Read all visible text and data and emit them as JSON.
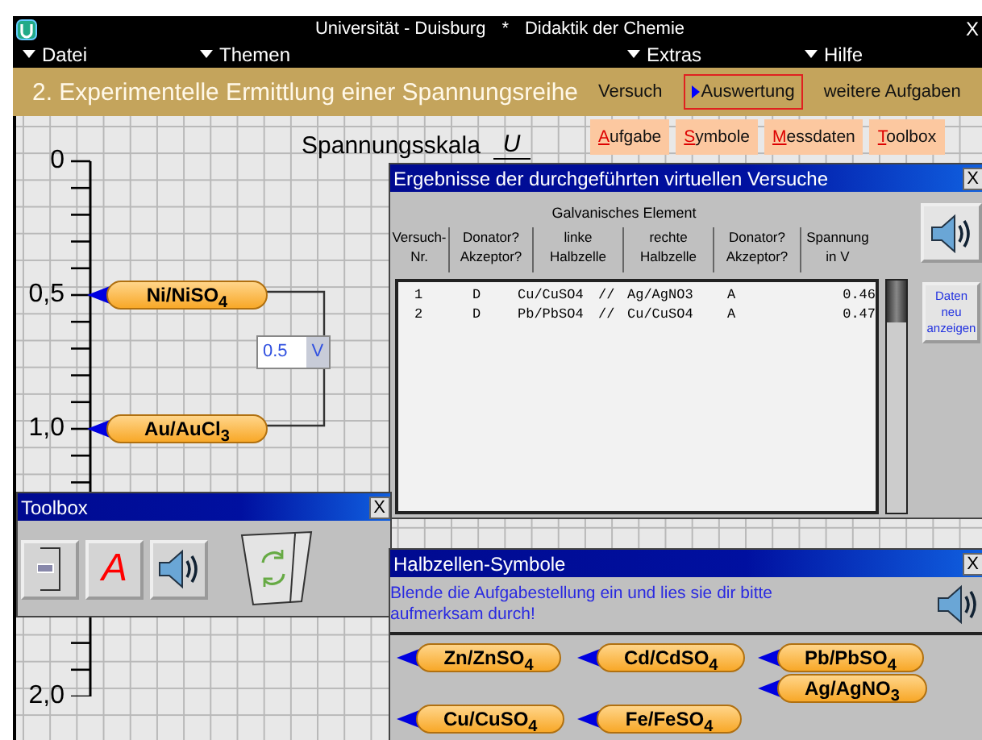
{
  "window": {
    "title_left": "Universität - Duisburg",
    "title_separator": "*",
    "title_right": "Didaktik der Chemie",
    "close": "X"
  },
  "menu": [
    {
      "label": "Datei"
    },
    {
      "label": "Themen"
    },
    {
      "label": "Extras"
    },
    {
      "label": "Hilfe"
    }
  ],
  "header": {
    "title": "2. Experimentelle Ermittlung einer Spannungsreihe",
    "nav": [
      {
        "label": "Versuch",
        "selected": false
      },
      {
        "label": "Auswertung",
        "selected": true
      },
      {
        "label": "weitere Aufgaben",
        "selected": false
      }
    ]
  },
  "subtabs": [
    {
      "label": "Aufgabe"
    },
    {
      "label": "Symbole"
    },
    {
      "label": "Messdaten"
    },
    {
      "label": "Toolbox"
    }
  ],
  "scale": {
    "title": "Spannungsskala",
    "unit_numerator": "U",
    "labels": [
      "0",
      "0,5",
      "1,0",
      "2,0"
    ]
  },
  "cells_on_scale": [
    {
      "label": "Ni/NiSO$_{4}$"
    },
    {
      "label": "Au/AuCl$_{3}$"
    }
  ],
  "voltmeter": {
    "value": "0.5",
    "unit": "V"
  },
  "results": {
    "title": "Ergebnisse der durchgeführten virtuellen Versuche",
    "close": "X",
    "group_header": "Galvanisches Element",
    "columns": [
      "Versuch-\nNr.",
      "Donator?\nAkzeptor?",
      "linke\nHalbzelle",
      "rechte\nHalbzelle",
      "Donator?\nAkzeptor?",
      "Spannung\nin V"
    ],
    "rows": [
      {
        "nr": "1",
        "left_role": "D",
        "left": "Cu/CuSO4",
        "separator": "//",
        "right": "Ag/AgNO3",
        "right_role": "A",
        "voltage": "0.46"
      },
      {
        "nr": "2",
        "left_role": "D",
        "left": "Pb/PbSO4",
        "separator": "//",
        "right": "Cu/CuSO4",
        "right_role": "A",
        "voltage": "0.47"
      }
    ],
    "refresh_button": "Daten neu anzeigen"
  },
  "toolbox": {
    "title": "Toolbox",
    "close": "X",
    "text_tool": "A"
  },
  "halfcells": {
    "title": "Halbzellen-Symbole",
    "close": "X",
    "hint": "Blende die Aufgabestellung ein und lies sie dir bitte aufmerksam durch!",
    "items": [
      {
        "label": "Zn/ZnSO$_{4}$"
      },
      {
        "label": "Cd/CdSO$_{4}$"
      },
      {
        "label": "Pb/PbSO$_{4}$"
      },
      {
        "label": "Ag/AgNO$_{3}$"
      },
      {
        "label": "Cu/CuSO$_{4}$"
      },
      {
        "label": "Fe/FeSO$_{4}$"
      }
    ]
  }
}
